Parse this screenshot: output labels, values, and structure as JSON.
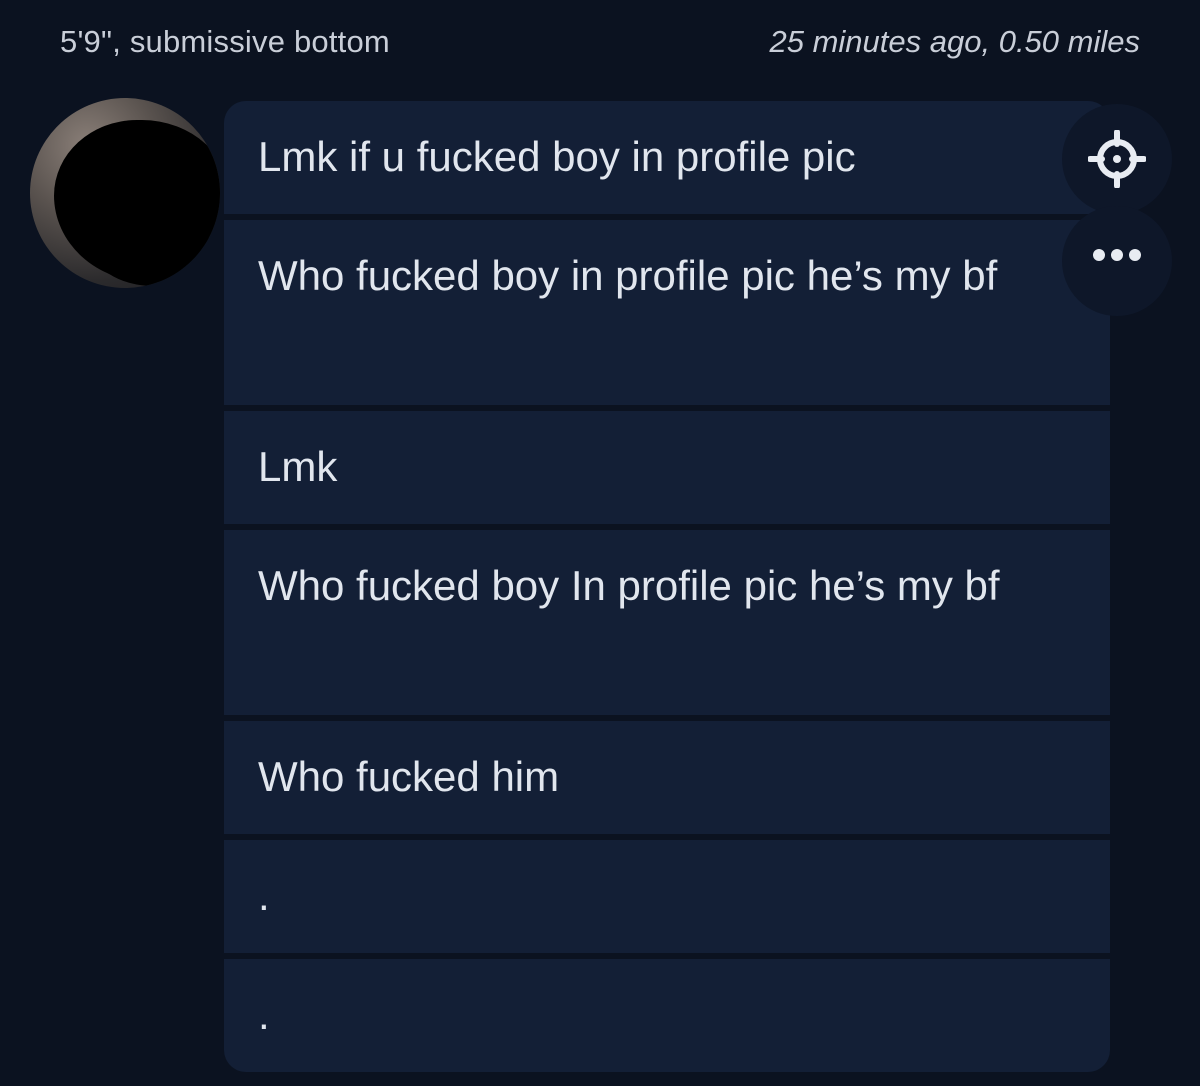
{
  "header": {
    "profile_summary": "5'9\", submissive bottom",
    "time_distance": "25 minutes ago, 0.50 miles"
  },
  "messages": [
    {
      "text": "Lmk if u fucked boy in profile pic"
    },
    {
      "text": "Who fucked boy in profile pic he’s my bf"
    },
    {
      "text": "Lmk"
    },
    {
      "text": "Who fucked boy In profile pic he’s my bf"
    },
    {
      "text": "Who fucked him"
    },
    {
      "text": "."
    },
    {
      "text": "."
    }
  ],
  "actions": {
    "target_icon": "crosshair-icon",
    "more_icon": "more-horizontal-icon"
  },
  "colors": {
    "background": "#0b1220",
    "bubble": "#131f36",
    "text": "#e1e6ee"
  }
}
